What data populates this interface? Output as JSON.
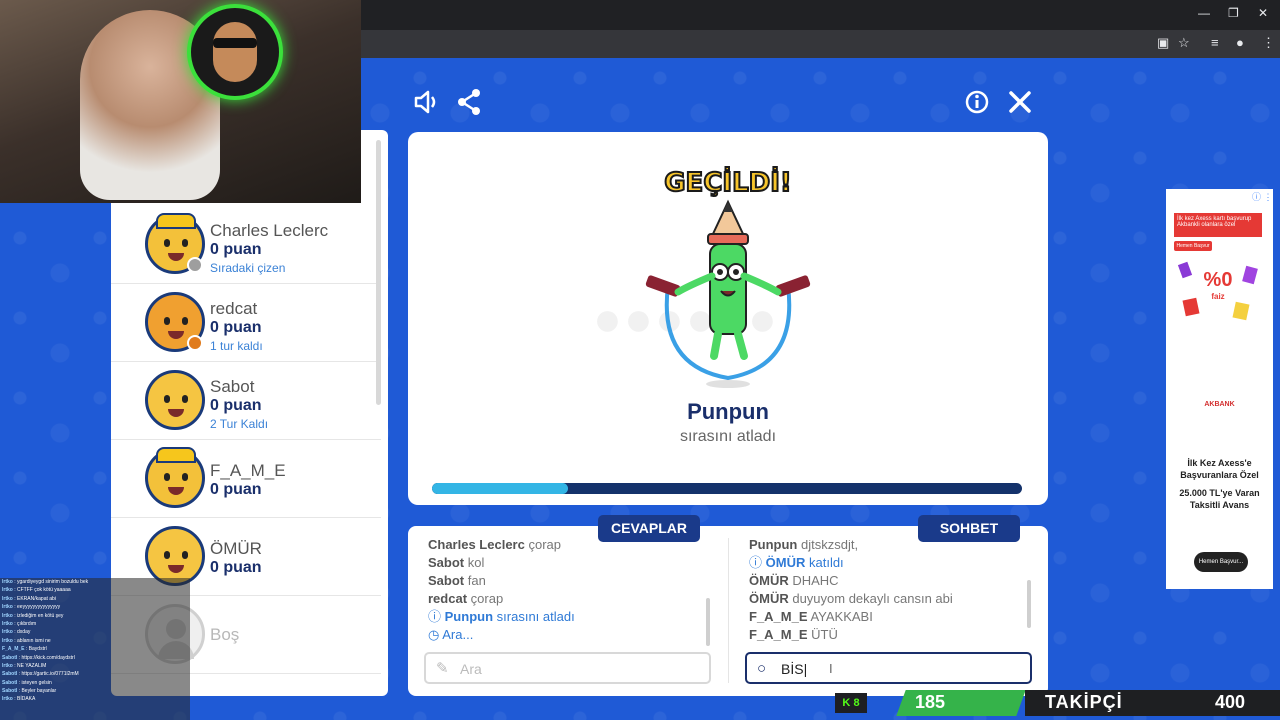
{
  "colors": {
    "game_bg": "#1f5ad6",
    "navy": "#1a2f6b",
    "accent_blue": "#2f7ad6",
    "progress": "#33b5e5",
    "banner_yellow": "#f7c52b",
    "kick_green": "#53fc18",
    "follower_green": "#35b34a"
  },
  "browser": {
    "window_controls": [
      "—",
      "❐",
      "✕"
    ],
    "toolbar_icons": [
      "install-app-icon",
      "star-icon",
      "media-icon",
      "extension-icon",
      "menu-icon"
    ]
  },
  "game_header": {
    "icons": [
      "speaker-icon",
      "share-icon",
      "info-icon",
      "close-icon"
    ]
  },
  "players": [
    {
      "name": "Charles Leclerc",
      "score": "0 puan",
      "status": "Sıradaki çizen",
      "status_color": "#9e9e9e",
      "avatar_bg": "#f3c13a",
      "has_cap": true
    },
    {
      "name": "redcat",
      "score": "0 puan",
      "status": "1 tur kaldı",
      "status_color": "#e07b1c",
      "avatar_bg": "#f0a030",
      "has_cap": false
    },
    {
      "name": "Sabot",
      "score": "0 puan",
      "status": "2 Tur Kaldı",
      "status_color": "",
      "avatar_bg": "#f5c542",
      "has_cap": false
    },
    {
      "name": "F_A_M_E",
      "score": "0 puan",
      "status": "",
      "status_color": "",
      "avatar_bg": "#f3c13a",
      "has_cap": true
    },
    {
      "name": "ÖMÜR",
      "score": "0 puan",
      "status": "",
      "status_color": "",
      "avatar_bg": "#f5c542",
      "has_cap": false
    },
    {
      "name": "Boş",
      "score": "",
      "status": "",
      "status_color": "",
      "avatar_bg": "#e8e8e8",
      "has_cap": false
    }
  ],
  "main": {
    "banner": "GEÇİLDİ!",
    "player_name": "Punpun",
    "subtitle": "sırasını atladı",
    "progress": 0.23
  },
  "tabs": {
    "answers": "CEVAPLAR",
    "chat": "SOHBET"
  },
  "answers": [
    {
      "user": "Charles Leclerc",
      "text": "çorap",
      "type": "msg"
    },
    {
      "user": "Sabot",
      "text": "kol",
      "type": "msg"
    },
    {
      "user": "Sabot",
      "text": "fan",
      "type": "msg"
    },
    {
      "user": "redcat",
      "text": "çorap",
      "type": "msg"
    },
    {
      "user": "Punpun",
      "text": "sırasını atladı",
      "type": "sys",
      "icon": "info-icon"
    },
    {
      "user": "",
      "text": "Ara...",
      "type": "sys",
      "icon": "clock-icon"
    }
  ],
  "chat": [
    {
      "user": "Punpun",
      "text": "djtskzsdjt,",
      "type": "msg"
    },
    {
      "user": "ÖMÜR",
      "text": "katıldı",
      "type": "sys",
      "icon": "info-icon"
    },
    {
      "user": "ÖMÜR",
      "text": "DHAHC",
      "type": "msg"
    },
    {
      "user": "ÖMÜR",
      "text": "duyuyom dekaylı cansın abi",
      "type": "msg"
    },
    {
      "user": "F_A_M_E",
      "text": "AYAKKABI",
      "type": "msg"
    },
    {
      "user": "F_A_M_E",
      "text": "ÜTÜ",
      "type": "msg"
    }
  ],
  "inputs": {
    "answers_placeholder": "Ara",
    "chat_value": "BİS"
  },
  "ad": {
    "banner": "İlk kez Axess kartı başvurup Akbankli olanlara özel",
    "small_button": "Hemen Başvur",
    "percent": "%0",
    "percent_label": "faiz",
    "brand": "AKBANK",
    "copy1": "İlk Kez Axess'e Başvuranlara Özel",
    "copy2": "25.000 TL'ye Varan Taksitli Avans",
    "button": "Hemen Başvur..."
  },
  "stream_chat": [
    {
      "user": "lrtko",
      "text": "ygardiyeygd sinirim bozuldu bek"
    },
    {
      "user": "lrtko",
      "text": "CFTFF çok kötü yaaaaa"
    },
    {
      "user": "lrtko",
      "text": "EKRAN/kapat abi"
    },
    {
      "user": "lrtko",
      "text": "eeyyyyyyyyyyyyyyy"
    },
    {
      "user": "lrtko",
      "text": "izlediğim en kötü şey"
    },
    {
      "user": "lrtko",
      "text": "çıkbrdım"
    },
    {
      "user": "lrtko",
      "text": "dxday"
    },
    {
      "user": "lrtko",
      "text": "ablanın ismi ne"
    },
    {
      "user": "F_A_M_E",
      "text": "Baydstrl"
    },
    {
      "user": "Sabotl",
      "text": "https://kick.com/daydstrl"
    },
    {
      "user": "lrtko",
      "text": "NE YAZALIM"
    },
    {
      "user": "Sabotl",
      "text": "https://gartic.io/0771l2mM"
    },
    {
      "user": "Sabotl",
      "text": "isteyen gelsin"
    },
    {
      "user": "Sabotl",
      "text": "Beyler bayanlar"
    },
    {
      "user": "lrtko",
      "text": "BİDAKA"
    }
  ],
  "follower_bar": {
    "kick_count": "8",
    "count": "185",
    "label": "TAKİPÇİ",
    "goal": "400"
  }
}
